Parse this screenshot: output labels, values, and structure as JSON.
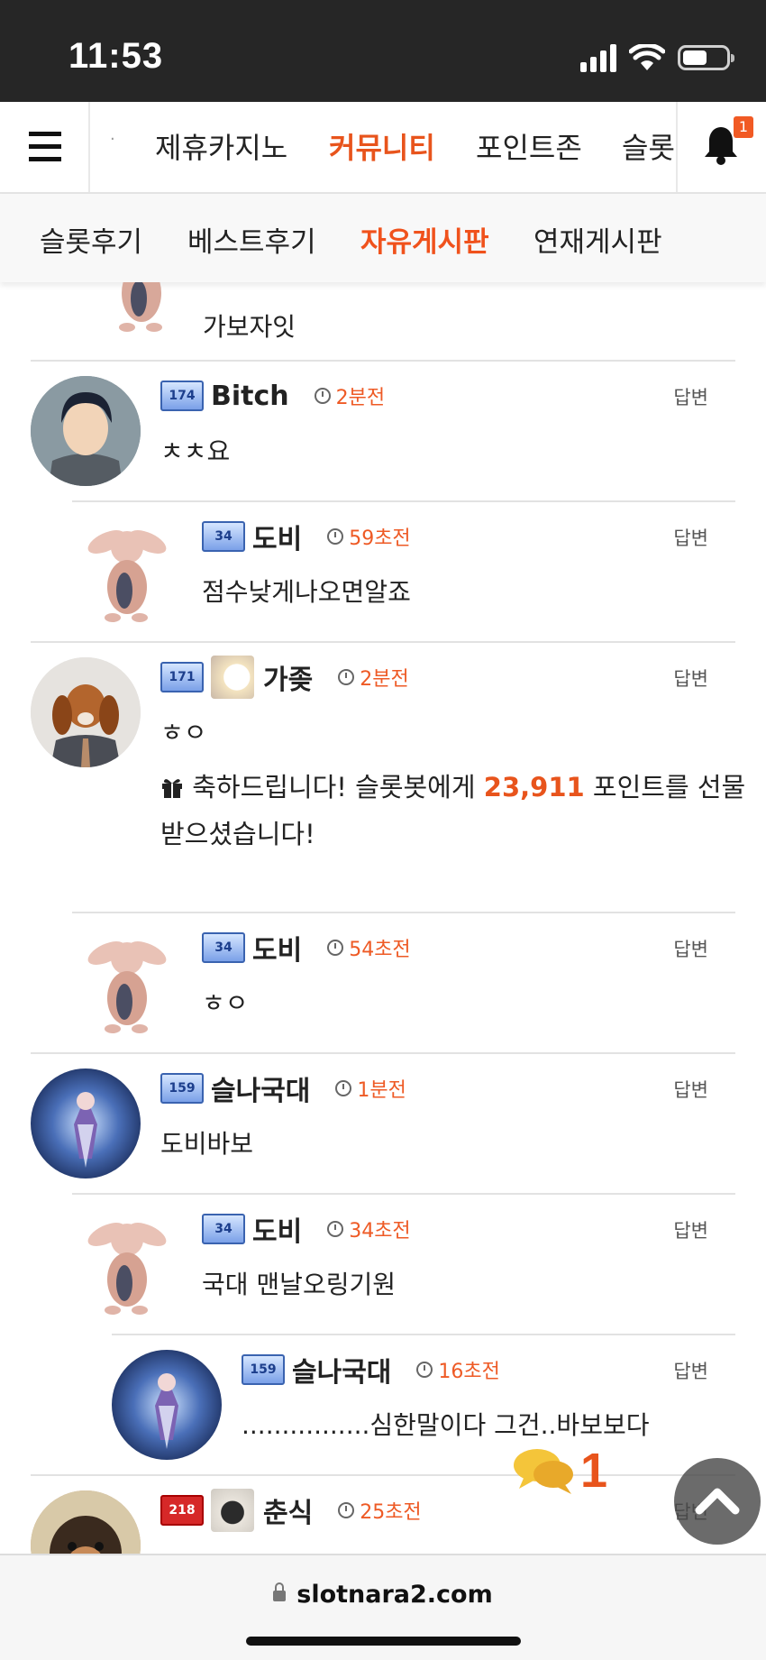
{
  "status_bar": {
    "time": "11:53",
    "battery_level": 0.55
  },
  "nav": {
    "items": [
      {
        "label": ".",
        "active": false
      },
      {
        "label": "제휴카지노",
        "active": false
      },
      {
        "label": "커뮤니티",
        "active": true
      },
      {
        "label": "포인트존",
        "active": false
      },
      {
        "label": "슬롯",
        "active": false
      }
    ],
    "notification_count": "1"
  },
  "subnav": {
    "items": [
      {
        "label": "슬롯후기",
        "active": false
      },
      {
        "label": "베스트후기",
        "active": false
      },
      {
        "label": "자유게시판",
        "active": true
      },
      {
        "label": "연재게시판",
        "active": false
      }
    ]
  },
  "comments": [
    {
      "nick": "",
      "text": "가보자잇"
    },
    {
      "nick": "Bitch",
      "level": "174",
      "time": "2분전",
      "reply": "답변",
      "text": "ㅊㅊ요"
    },
    {
      "nick": "도비",
      "level": "34",
      "time": "59초전",
      "reply": "답변",
      "text": "점수낮게나오면알죠"
    },
    {
      "nick": "가좆",
      "level": "171",
      "time": "2분전",
      "reply": "답변",
      "text": "ㅎㅇ",
      "gift_prefix": "축하드립니다! 슬롯봇에게 ",
      "gift_points": "23,911",
      "gift_suffix": " 포인트를 선물 받으셨습니다!"
    },
    {
      "nick": "도비",
      "level": "34",
      "time": "54초전",
      "reply": "답변",
      "text": "ㅎㅇ"
    },
    {
      "nick": "슬나국대",
      "level": "159",
      "time": "1분전",
      "reply": "답변",
      "text": "도비바보"
    },
    {
      "nick": "도비",
      "level": "34",
      "time": "34초전",
      "reply": "답변",
      "text": "국대 맨날오링기원"
    },
    {
      "nick": "슬나국대",
      "level": "159",
      "time": "16초전",
      "reply": "답변",
      "text": "................심한말이다 그건..바보보다"
    },
    {
      "nick": "춘식",
      "level": "218",
      "time": "25초전",
      "reply": "답변",
      "text": ""
    }
  ],
  "floating": {
    "chat_count": "1"
  },
  "browser": {
    "url": "slotnara2.com"
  },
  "colors": {
    "accent": "#e8541c",
    "status_bar": "#262626"
  }
}
